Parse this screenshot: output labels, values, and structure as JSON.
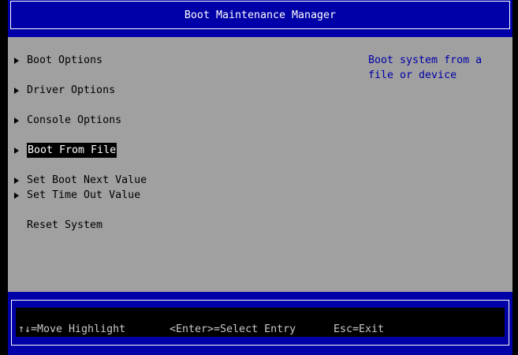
{
  "header": {
    "title": "Boot Maintenance Manager"
  },
  "menu": {
    "items": [
      {
        "label": "Boot Options",
        "submenu": true
      },
      {
        "label": "Driver Options",
        "submenu": true
      },
      {
        "label": "Console Options",
        "submenu": true
      },
      {
        "label": "Boot From File",
        "submenu": true,
        "selected": true
      },
      {
        "label": "Set Boot Next Value",
        "submenu": true
      },
      {
        "label": "Set Time Out Value",
        "submenu": true
      },
      {
        "label": "Reset System",
        "submenu": false
      }
    ]
  },
  "help": {
    "text": "Boot system from a\nfile or device"
  },
  "footer": {
    "move": "↑↓=Move Highlight",
    "select": "<Enter>=Select Entry",
    "exit": "Esc=Exit"
  },
  "colors": {
    "blue": "#0000a8",
    "gray": "#a0a0a0",
    "black": "#000000"
  }
}
